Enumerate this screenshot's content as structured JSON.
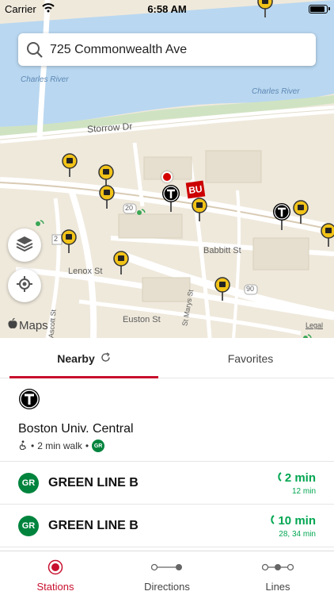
{
  "status_bar": {
    "carrier": "Carrier",
    "time": "6:58 AM",
    "battery_level": 0.95
  },
  "search": {
    "value": "725 Commonwealth Ave",
    "icon": "search-icon"
  },
  "map": {
    "labels": {
      "charles_river_1": "Charles River",
      "charles_river_2": "Charles River",
      "storrow": "Storrow Dr",
      "babbitt": "Babbitt St",
      "lenox": "Lenox St",
      "euston": "Euston St",
      "st_marys": "St Marys St",
      "ascott": "Ascott St",
      "route_20": "20",
      "route_90": "90",
      "route_2": "2"
    },
    "badge_bu": "BU",
    "logo": "Maps",
    "legal": "Legal",
    "controls": {
      "layers": "layers-icon",
      "locate": "locate-icon"
    }
  },
  "tabs": {
    "nearby": "Nearby",
    "favorites": "Favorites",
    "active": "nearby"
  },
  "station": {
    "name": "Boston Univ. Central",
    "walk": "2 min walk",
    "line_badge": "GR"
  },
  "routes": [
    {
      "badge": "GR",
      "name": "GREEN LINE B",
      "next": "2 min",
      "following": "12 min"
    },
    {
      "badge": "GR",
      "name": "GREEN LINE B",
      "next": "10 min",
      "following": "28, 34 min"
    }
  ],
  "tab_bar": {
    "stations": "Stations",
    "directions": "Directions",
    "lines": "Lines",
    "active": "stations"
  },
  "colors": {
    "accent": "#c8102e",
    "green_line": "#00843d",
    "arrival": "#00a651",
    "bus": "#f2c318",
    "water": "#b9d7f0"
  }
}
